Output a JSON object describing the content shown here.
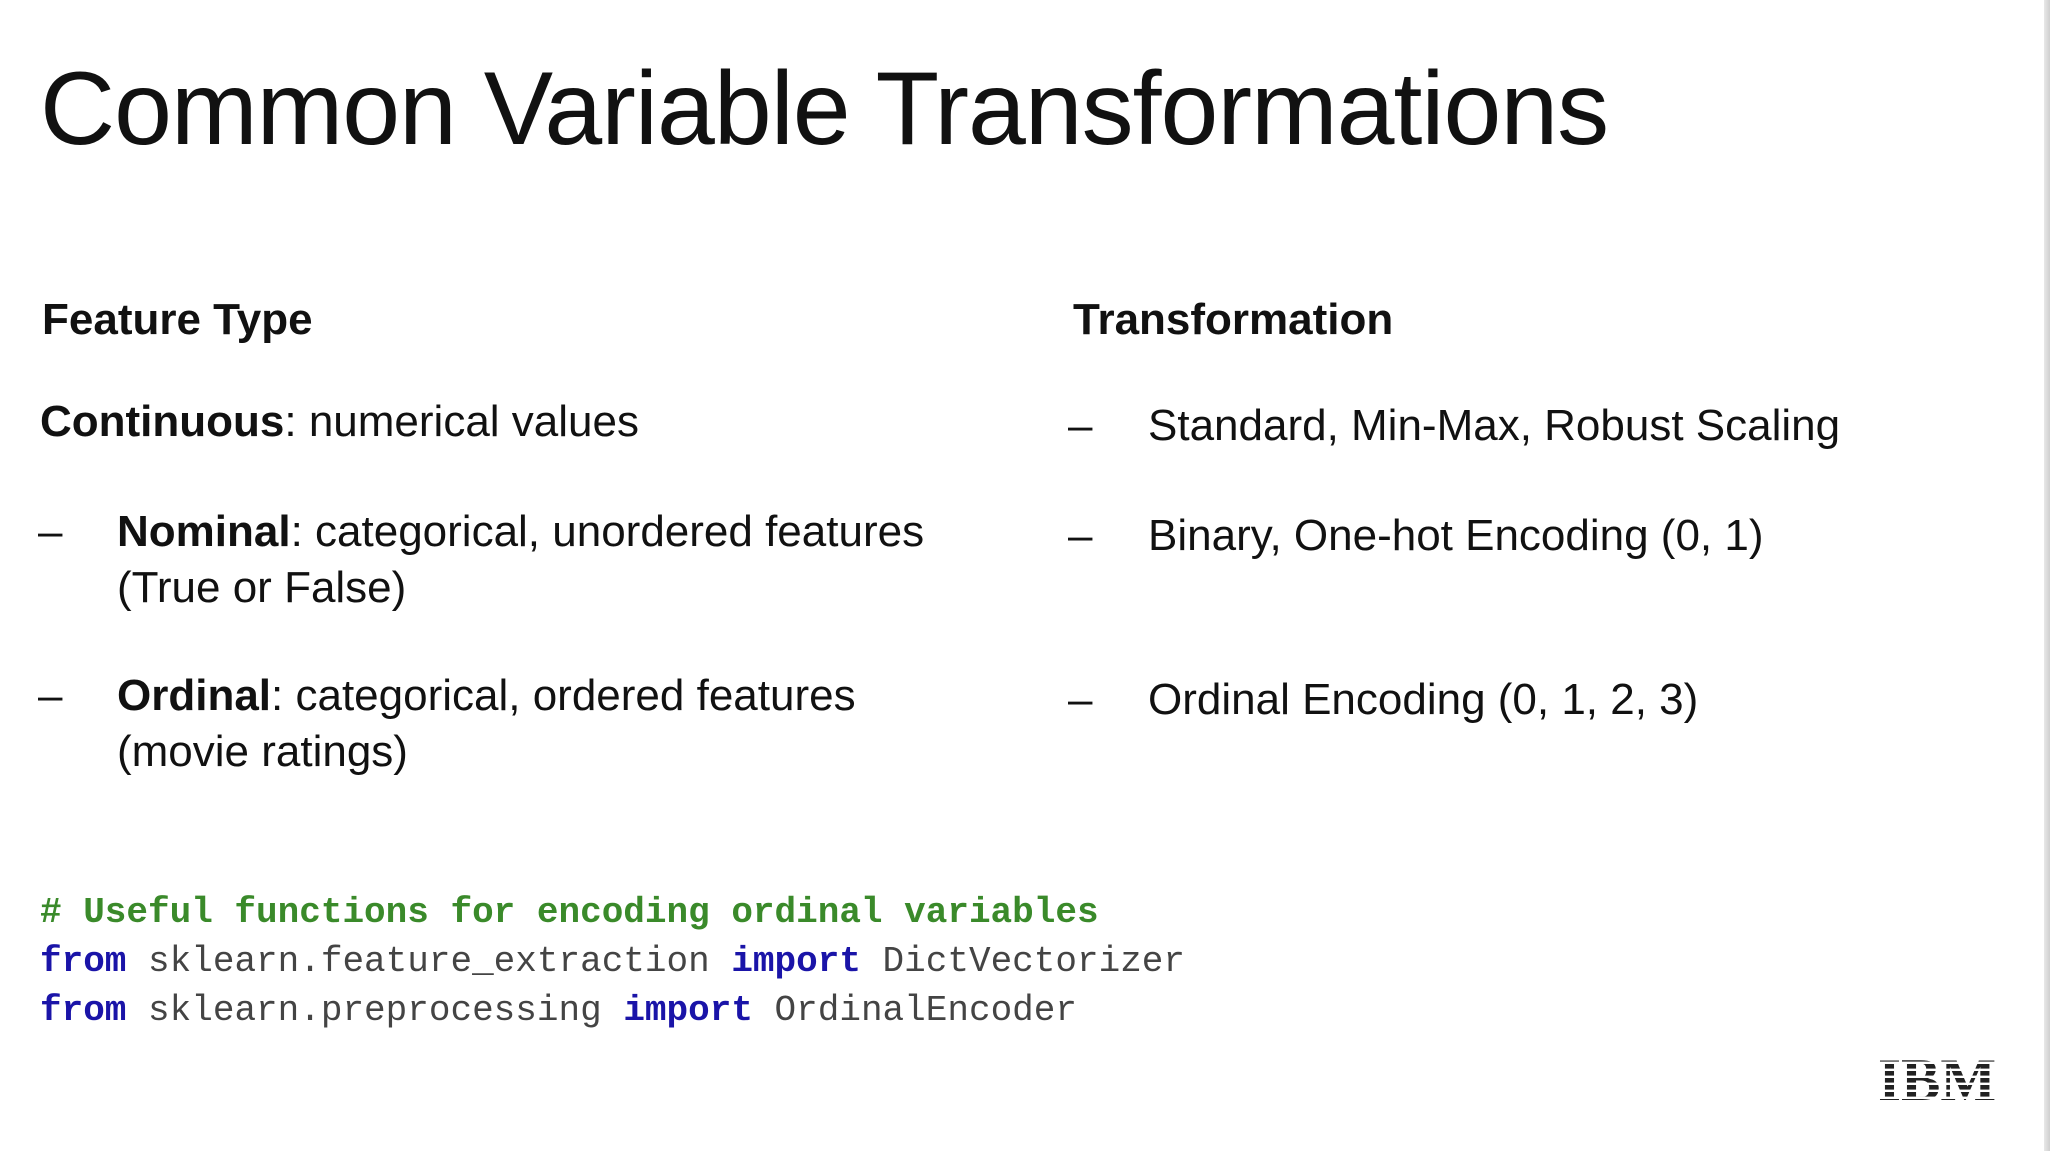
{
  "slide": {
    "title": "Common Variable Transformations",
    "headers": {
      "feature_type": "Feature Type",
      "transformation": "Transformation"
    },
    "rows": [
      {
        "feature_bold": "Continuous",
        "feature_rest": ": numerical values",
        "feature_line2": "",
        "transformation": "Standard, Min-Max, Robust Scaling"
      },
      {
        "feature_bold": "Nominal",
        "feature_rest": ": categorical, unordered features",
        "feature_line2": "(True or False)",
        "transformation": "Binary, One-hot Encoding (0, 1)"
      },
      {
        "feature_bold": "Ordinal",
        "feature_rest": ": categorical, ordered features",
        "feature_line2": "(movie ratings)",
        "transformation": "Ordinal Encoding (0, 1, 2, 3)"
      }
    ],
    "dash": "–",
    "code": {
      "comment": "# Useful functions for encoding ordinal variables",
      "line1": {
        "kw1": "from",
        "module": " sklearn.feature_extraction ",
        "kw2": "import",
        "name": " DictVectorizer"
      },
      "line2": {
        "kw1": "from",
        "module": " sklearn.preprocessing ",
        "kw2": "import",
        "name": " OrdinalEncoder"
      }
    },
    "logo": "IBM",
    "colors": {
      "comment": "#3a8a2a",
      "keyword": "#1a14a8",
      "code_text": "#444444",
      "logo": "#222222"
    }
  }
}
